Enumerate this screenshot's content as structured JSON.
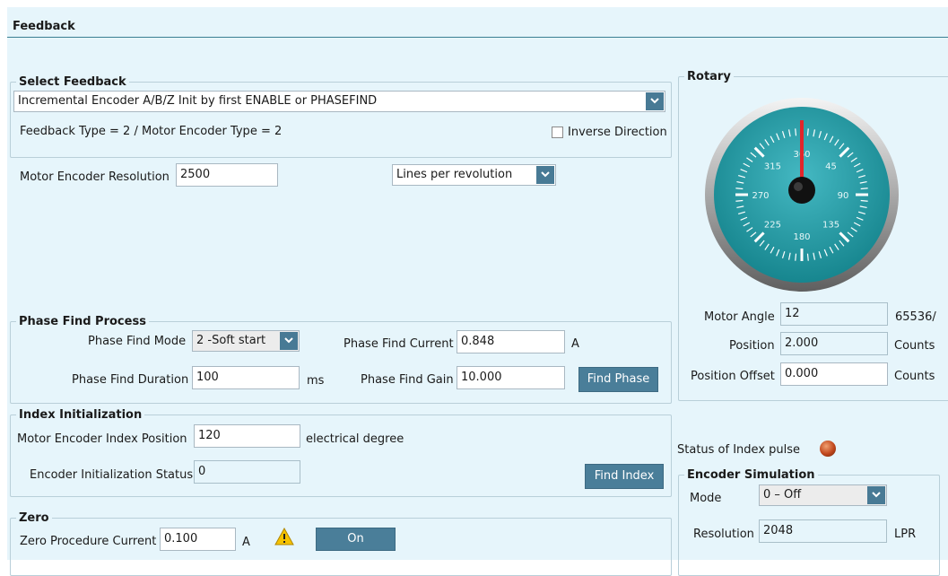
{
  "panel": {
    "title": "Feedback"
  },
  "select_feedback": {
    "legend": "Select Feedback",
    "dropdown_value": "Incremental Encoder A/B/Z Init by first ENABLE or PHASEFIND",
    "type_text": "Feedback Type =  2  /  Motor Encoder Type  =  2",
    "inverse_label": "Inverse Direction",
    "inverse_checked": false
  },
  "motor_encoder": {
    "resolution_label": "Motor Encoder Resolution",
    "resolution_value": "2500",
    "units_value": "Lines per revolution"
  },
  "phase_find": {
    "legend": "Phase Find Process",
    "mode_label": "Phase Find Mode",
    "mode_value": "2  -Soft start",
    "current_label": "Phase Find Current",
    "current_value": "0.848",
    "current_unit": "A",
    "duration_label": "Phase Find Duration",
    "duration_value": "100",
    "duration_unit": "ms",
    "gain_label": "Phase Find Gain",
    "gain_value": "10.000",
    "find_button": "Find Phase"
  },
  "index_init": {
    "legend": "Index Initialization",
    "position_label": "Motor Encoder Index Position",
    "position_value": "120",
    "position_unit": "electrical degree",
    "status_label": "Encoder Initialization Status",
    "status_value": "0",
    "find_button": "Find Index"
  },
  "zero": {
    "legend": "Zero",
    "current_label": "Zero Procedure Current",
    "current_value": "0.100",
    "current_unit": "A",
    "on_button": "On"
  },
  "rotary": {
    "legend": "Rotary",
    "gauge": {
      "labels": [
        "360",
        "45",
        "90",
        "135",
        "180",
        "225",
        "270",
        "315"
      ],
      "needle_angle_deg": 0,
      "needle_color": "#e3252a",
      "face_color": "#1f9aa5"
    },
    "motor_angle_label": "Motor Angle",
    "motor_angle_value": "12",
    "motor_angle_unit": "65536/",
    "position_label": "Position",
    "position_value": "2.000",
    "position_unit": "Counts",
    "offset_label": "Position Offset",
    "offset_value": "0.000",
    "offset_unit": "Counts"
  },
  "index_pulse": {
    "label": "Status of Index pulse",
    "led_color": "#c0461c"
  },
  "encoder_sim": {
    "legend": "Encoder Simulation",
    "mode_label": "Mode",
    "mode_value": "0 – Off",
    "resolution_label": "Resolution",
    "resolution_value": "2048",
    "resolution_unit": "LPR"
  }
}
